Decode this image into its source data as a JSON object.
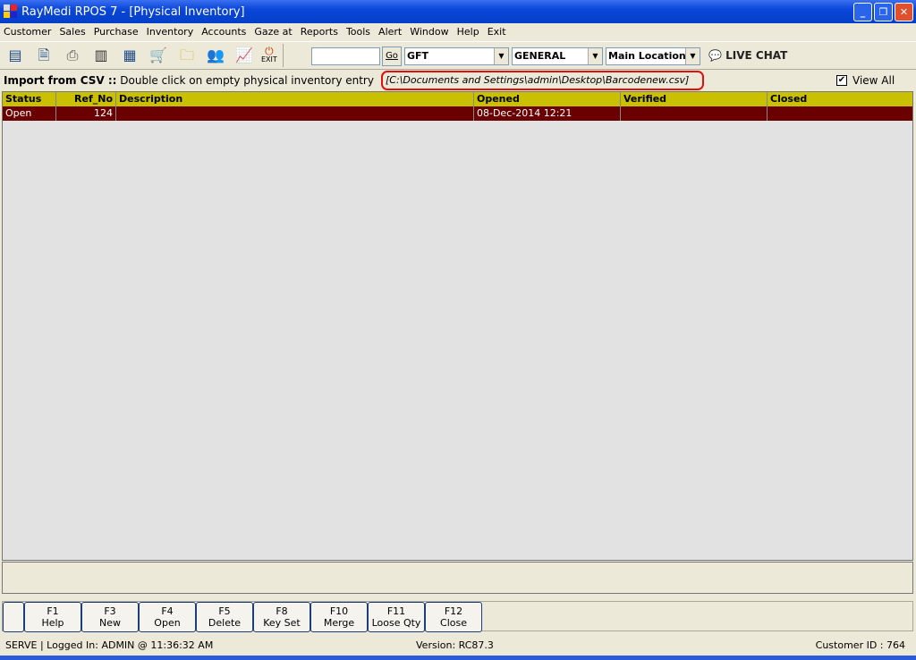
{
  "window": {
    "title": "RayMedi RPOS 7 - [Physical Inventory]"
  },
  "menu": [
    "Customer",
    "Sales",
    "Purchase",
    "Inventory",
    "Accounts",
    "Gaze at",
    "Reports",
    "Tools",
    "Alert",
    "Window",
    "Help",
    "Exit"
  ],
  "toolbar": {
    "exit_label": "EXIT",
    "go_label": "Go",
    "search_value": "",
    "combo1": "GFT",
    "combo2": "GENERAL",
    "combo3": "Main Location",
    "live_chat": "LIVE CHAT"
  },
  "info": {
    "label": "Import from CSV ::",
    "text": "Double click on empty physical inventory entry",
    "path": "[C:\\Documents and Settings\\admin\\Desktop\\Barcodenew.csv]",
    "view_all": "View All",
    "view_all_checked": true
  },
  "table": {
    "headers": [
      "Status",
      "Ref_No",
      "Description",
      "Opened",
      "Verified",
      "Closed"
    ],
    "rows": [
      [
        "Open",
        "124",
        "",
        "08-Dec-2014 12:21",
        "",
        ""
      ]
    ]
  },
  "fkeys": [
    {
      "key": "F1",
      "label": "Help"
    },
    {
      "key": "F3",
      "label": "New"
    },
    {
      "key": "F4",
      "label": "Open"
    },
    {
      "key": "F5",
      "label": "Delete"
    },
    {
      "key": "F8",
      "label": "Key Set"
    },
    {
      "key": "F10",
      "label": "Merge"
    },
    {
      "key": "F11",
      "label": "Loose Qty"
    },
    {
      "key": "F12",
      "label": "Close"
    }
  ],
  "status": {
    "left": "SERVE |  Logged In: ADMIN  @ 11:36:32 AM",
    "version": "Version: RC87.3",
    "customer": "Customer ID : 764"
  }
}
